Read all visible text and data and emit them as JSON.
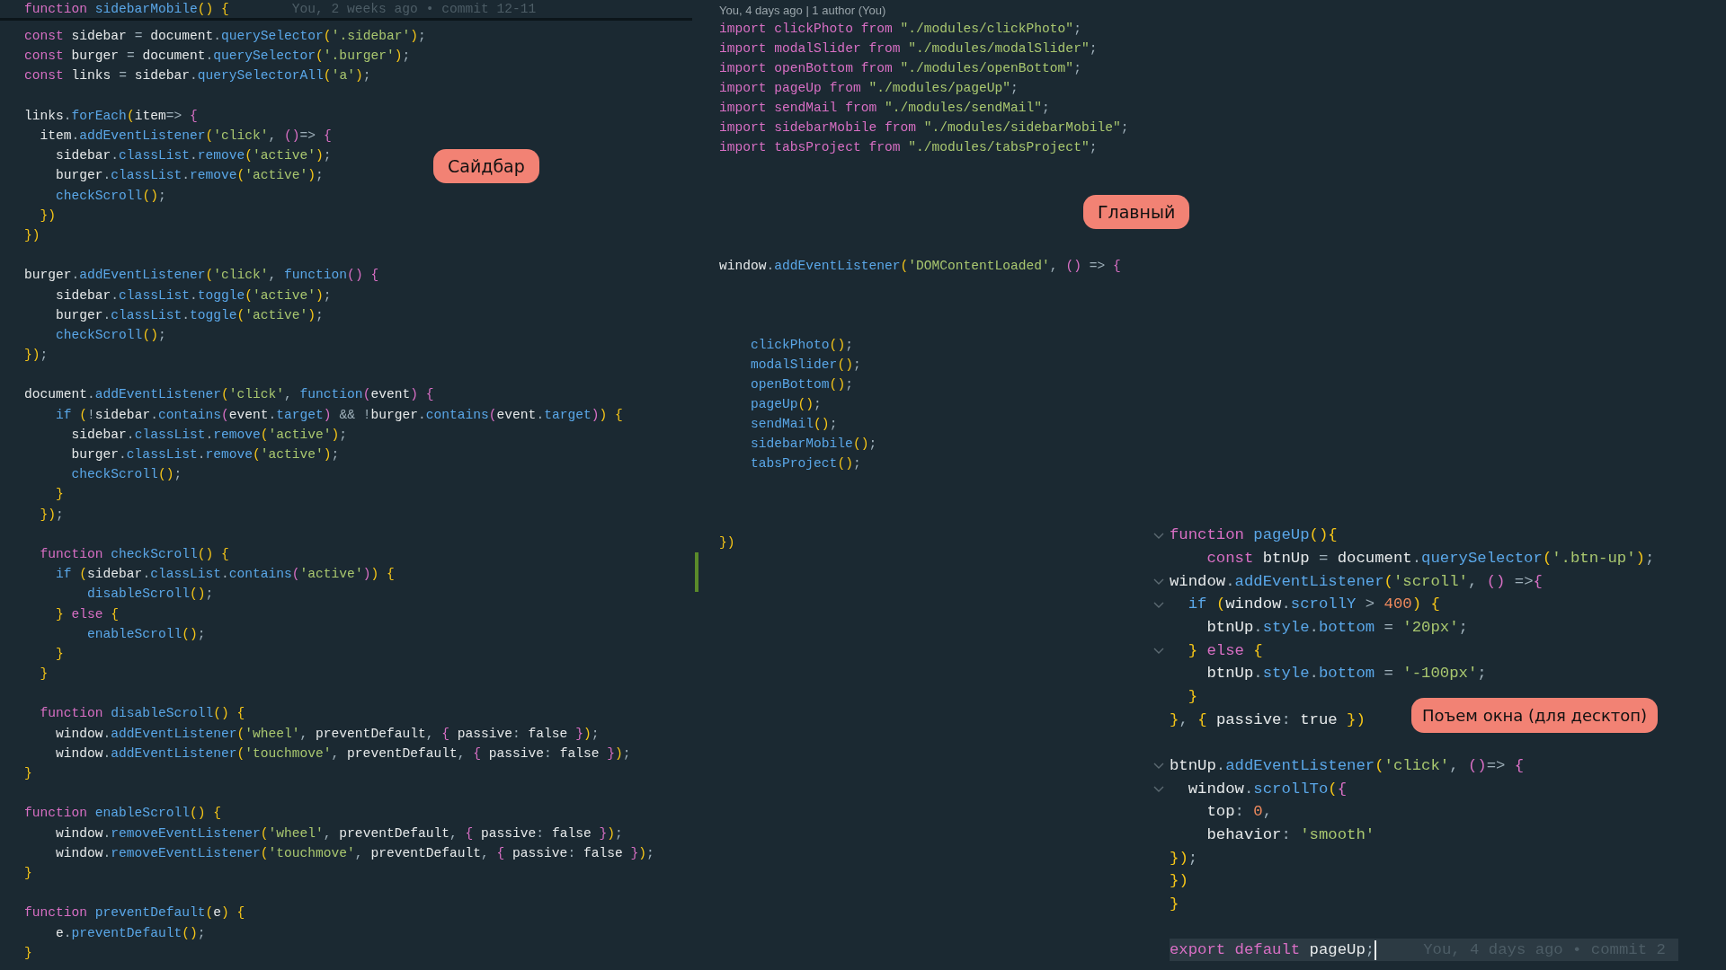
{
  "panels": [
    {
      "sticky": {
        "text": "function sidebarMobile() {",
        "blame": "You, 2 weeks ago • commit 12-11"
      },
      "lines": [
        {
          "kind": "code",
          "text": "const sidebar = document.querySelector('.sidebar');"
        },
        {
          "kind": "code",
          "text": "const burger = document.querySelector('.burger');"
        },
        {
          "kind": "code",
          "text": "const links = sidebar.querySelectorAll('a');"
        },
        {
          "kind": "blank"
        },
        {
          "kind": "code",
          "text": "links.forEach(item=> {"
        },
        {
          "kind": "code",
          "text": "  item.addEventListener('click', ()=> {"
        },
        {
          "kind": "code",
          "text": "    sidebar.classList.remove('active');"
        },
        {
          "kind": "code",
          "text": "    burger.classList.remove('active');"
        },
        {
          "kind": "code",
          "text": "    checkScroll();"
        },
        {
          "kind": "code",
          "text": "  })"
        },
        {
          "kind": "code",
          "text": "})"
        },
        {
          "kind": "blank"
        },
        {
          "kind": "code",
          "text": "burger.addEventListener('click', function() {"
        },
        {
          "kind": "code",
          "text": "    sidebar.classList.toggle('active');"
        },
        {
          "kind": "code",
          "text": "    burger.classList.toggle('active');"
        },
        {
          "kind": "code",
          "text": "    checkScroll();"
        },
        {
          "kind": "code",
          "text": "});"
        },
        {
          "kind": "blank"
        },
        {
          "kind": "code",
          "text": "document.addEventListener('click', function(event) {"
        },
        {
          "kind": "code",
          "text": "    if (!sidebar.contains(event.target) && !burger.contains(event.target)) {"
        },
        {
          "kind": "code",
          "text": "      sidebar.classList.remove('active');"
        },
        {
          "kind": "code",
          "text": "      burger.classList.remove('active');"
        },
        {
          "kind": "code",
          "text": "      checkScroll();"
        },
        {
          "kind": "code",
          "text": "    }"
        },
        {
          "kind": "code",
          "text": "  });"
        },
        {
          "kind": "blank"
        },
        {
          "kind": "code",
          "text": "  function checkScroll() {"
        },
        {
          "kind": "code",
          "text": "    if (sidebar.classList.contains('active')) {"
        },
        {
          "kind": "code",
          "text": "        disableScroll();"
        },
        {
          "kind": "code",
          "text": "    } else {"
        },
        {
          "kind": "code",
          "text": "        enableScroll();"
        },
        {
          "kind": "code",
          "text": "    }"
        },
        {
          "kind": "code",
          "text": "  }"
        },
        {
          "kind": "blank"
        },
        {
          "kind": "code",
          "text": "  function disableScroll() {"
        },
        {
          "kind": "code",
          "text": "    window.addEventListener('wheel', preventDefault, { passive: false });"
        },
        {
          "kind": "code",
          "text": "    window.addEventListener('touchmove', preventDefault, { passive: false });"
        },
        {
          "kind": "code",
          "text": "}"
        },
        {
          "kind": "blank"
        },
        {
          "kind": "code",
          "text": "function enableScroll() {"
        },
        {
          "kind": "code",
          "text": "    window.removeEventListener('wheel', preventDefault, { passive: false });"
        },
        {
          "kind": "code",
          "text": "    window.removeEventListener('touchmove', preventDefault, { passive: false });"
        },
        {
          "kind": "code",
          "text": "}"
        },
        {
          "kind": "blank"
        },
        {
          "kind": "code",
          "text": "function preventDefault(e) {"
        },
        {
          "kind": "code",
          "text": "    e.preventDefault();"
        },
        {
          "kind": "code",
          "text": "}"
        }
      ]
    },
    {
      "codelens": "You, 4 days ago | 1 author (You)",
      "lines": [
        {
          "kind": "code",
          "text": "import clickPhoto from \"./modules/clickPhoto\";"
        },
        {
          "kind": "code",
          "text": "import modalSlider from \"./modules/modalSlider\";"
        },
        {
          "kind": "code",
          "text": "import openBottom from \"./modules/openBottom\";"
        },
        {
          "kind": "code",
          "text": "import pageUp from \"./modules/pageUp\";"
        },
        {
          "kind": "code",
          "text": "import sendMail from \"./modules/sendMail\";"
        },
        {
          "kind": "code",
          "text": "import sidebarMobile from \"./modules/sidebarMobile\";"
        },
        {
          "kind": "code",
          "text": "import tabsProject from \"./modules/tabsProject\";"
        },
        {
          "kind": "blank"
        },
        {
          "kind": "blank"
        },
        {
          "kind": "blank"
        },
        {
          "kind": "blank"
        },
        {
          "kind": "blank"
        },
        {
          "kind": "code",
          "text": "window.addEventListener('DOMContentLoaded', () => {"
        },
        {
          "kind": "blank"
        },
        {
          "kind": "blank"
        },
        {
          "kind": "blank"
        },
        {
          "kind": "code",
          "text": "    clickPhoto();"
        },
        {
          "kind": "code",
          "text": "    modalSlider();"
        },
        {
          "kind": "code",
          "text": "    openBottom();"
        },
        {
          "kind": "code",
          "text": "    pageUp();"
        },
        {
          "kind": "code",
          "text": "    sendMail();"
        },
        {
          "kind": "code",
          "text": "    sidebarMobile();"
        },
        {
          "kind": "code",
          "text": "    tabsProject();"
        },
        {
          "kind": "blank"
        },
        {
          "kind": "blank"
        },
        {
          "kind": "blank"
        },
        {
          "kind": "code",
          "text": "})"
        },
        {
          "kind": "blank",
          "modified": true
        },
        {
          "kind": "blank",
          "modified": true
        }
      ]
    },
    {
      "lines": [
        {
          "kind": "code",
          "text": "function pageUp(){",
          "expanded": true
        },
        {
          "kind": "code",
          "text": "    const btnUp = document.querySelector('.btn-up');"
        },
        {
          "kind": "code",
          "text": "window.addEventListener('scroll', () =>{",
          "expanded": true
        },
        {
          "kind": "code",
          "text": "  if (window.scrollY > 400) {",
          "expanded": true
        },
        {
          "kind": "code",
          "text": "    btnUp.style.bottom = '20px';"
        },
        {
          "kind": "code",
          "text": "  } else {",
          "expanded": true
        },
        {
          "kind": "code",
          "text": "    btnUp.style.bottom = '-100px';"
        },
        {
          "kind": "code",
          "text": "  }"
        },
        {
          "kind": "code",
          "text": "}, { passive: true })"
        },
        {
          "kind": "blank"
        },
        {
          "kind": "code",
          "text": "btnUp.addEventListener('click', ()=> {",
          "expanded": true
        },
        {
          "kind": "code",
          "text": "  window.scrollTo({",
          "expanded": true
        },
        {
          "kind": "code",
          "text": "    top: 0,"
        },
        {
          "kind": "code",
          "text": "    behavior: 'smooth'"
        },
        {
          "kind": "code",
          "text": "});"
        },
        {
          "kind": "code",
          "text": "})"
        },
        {
          "kind": "code",
          "text": "}"
        },
        {
          "kind": "blank"
        },
        {
          "kind": "code",
          "text": "export default pageUp;",
          "current": true,
          "blame": "You, 4 days ago • commit 2"
        }
      ]
    }
  ],
  "labels": [
    {
      "text": "Сайдбар"
    },
    {
      "text": "Главный"
    },
    {
      "text": "Поъем окна (для десктоп)"
    }
  ]
}
